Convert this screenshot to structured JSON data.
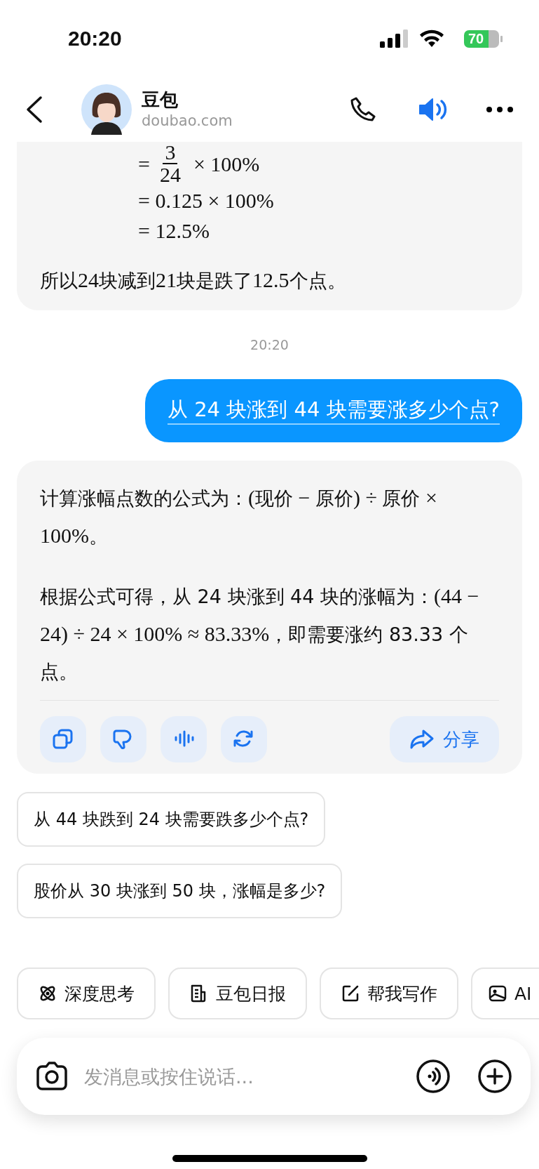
{
  "status_bar": {
    "time": "20:20",
    "battery": "70"
  },
  "header": {
    "title": "豆包",
    "subtitle": "doubao.com"
  },
  "messages": [
    {
      "kind": "assistant",
      "cut": true,
      "formula_lines": [
        {
          "kind": "fraction",
          "prefix": "=",
          "numerator": "3",
          "denominator": "24",
          "suffix": "× 100%"
        },
        {
          "kind": "plain",
          "text": "= 0.125 × 100%"
        },
        {
          "kind": "plain",
          "text": "= 12.5%"
        }
      ],
      "paragraphs": [
        [
          {
            "kind": "text",
            "text": "所以"
          },
          {
            "kind": "math",
            "text": "24"
          },
          {
            "kind": "text",
            "text": "块减到"
          },
          {
            "kind": "math",
            "text": "21"
          },
          {
            "kind": "text",
            "text": "块是跌了"
          },
          {
            "kind": "math",
            "text": "12.5"
          },
          {
            "kind": "text",
            "text": "个点。"
          }
        ]
      ]
    },
    {
      "kind": "timestamp",
      "text": "20:20"
    },
    {
      "kind": "user",
      "text": "从 24 块涨到 44 块需要涨多少个点?"
    },
    {
      "kind": "assistant",
      "cut": false,
      "paragraphs": [
        [
          {
            "kind": "text",
            "text": "计算涨幅点数的公式为："
          },
          {
            "kind": "math",
            "text": "("
          },
          {
            "kind": "text",
            "text": "现价"
          },
          {
            "kind": "math",
            "text": " − "
          },
          {
            "kind": "text",
            "text": "原价"
          },
          {
            "kind": "math",
            "text": ") ÷ "
          },
          {
            "kind": "text",
            "text": "原价"
          },
          {
            "kind": "math",
            "text": " × 100%"
          },
          {
            "kind": "text",
            "text": "。"
          }
        ],
        [
          {
            "kind": "text",
            "text": "根据公式可得，从 24 块涨到 44 块的涨幅为："
          },
          {
            "kind": "math",
            "text": "(44 − 24) ÷ 24 × 100% ≈ 83.33%"
          },
          {
            "kind": "text",
            "text": "，即需要涨约 83.33 个点。"
          }
        ]
      ],
      "share": "分享"
    }
  ],
  "suggestions": [
    "从 44 块跌到 24 块需要跌多少个点?",
    "股价从 30 块涨到 50 块，涨幅是多少?"
  ],
  "shortcuts": [
    "深度思考",
    "豆包日报",
    "帮我写作",
    "AI"
  ],
  "input": {
    "placeholder": "发消息或按住说话..."
  }
}
